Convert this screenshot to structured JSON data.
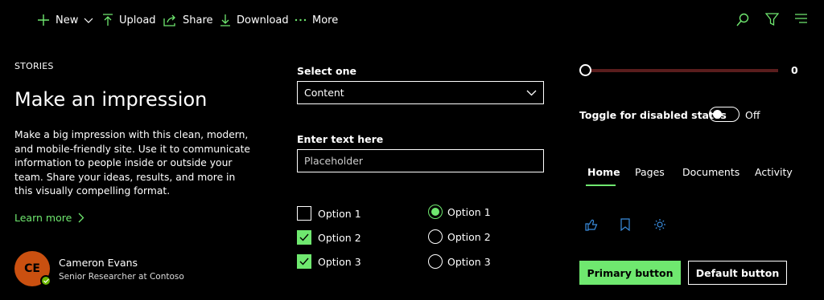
{
  "command_bar": {
    "new_label": "New",
    "upload_label": "Upload",
    "share_label": "Share",
    "download_label": "Download",
    "more_label": "More",
    "icon_color": "#6fe86f",
    "right_icons": [
      "search-icon",
      "filter-icon",
      "menu-icon"
    ]
  },
  "story": {
    "eyebrow": "STORIES",
    "title": "Make an impression",
    "description": "Make a big impression with this clean, modern, and mobile-friendly site. Use it to communicate information to people inside or outside your team. Share your ideas, results, and more in this visually compelling format.",
    "link_label": "Learn more"
  },
  "persona": {
    "initials": "CE",
    "name": "Cameron Evans",
    "role": "Senior Researcher at Contoso",
    "avatar_color": "#ca5010",
    "presence": "available"
  },
  "form": {
    "select_label": "Select one",
    "select_value": "Content",
    "text_label": "Enter text here",
    "text_placeholder": "Placeholder",
    "checkboxes": [
      {
        "label": "Option 1",
        "checked": false
      },
      {
        "label": "Option 2",
        "checked": true
      },
      {
        "label": "Option 3",
        "checked": true
      }
    ],
    "radios": [
      {
        "label": "Option 1",
        "selected": true
      },
      {
        "label": "Option 2",
        "selected": false
      },
      {
        "label": "Option 3",
        "selected": false
      }
    ]
  },
  "slider": {
    "value": "0",
    "fraction": 0
  },
  "toggle": {
    "label": "Toggle for disabled states",
    "state": "Off"
  },
  "pivot": {
    "tabs": [
      "Home",
      "Pages",
      "Documents",
      "Activity"
    ],
    "active": "Home"
  },
  "icon_buttons": [
    "like-icon",
    "bookmark-icon",
    "sun-icon"
  ],
  "buttons": {
    "primary": "Primary button",
    "default": "Default button"
  },
  "colors": {
    "accent": "#6fe86f",
    "background": "#000000",
    "slider_track": "#5a1d1d",
    "icon_blue": "#3a8dde"
  }
}
